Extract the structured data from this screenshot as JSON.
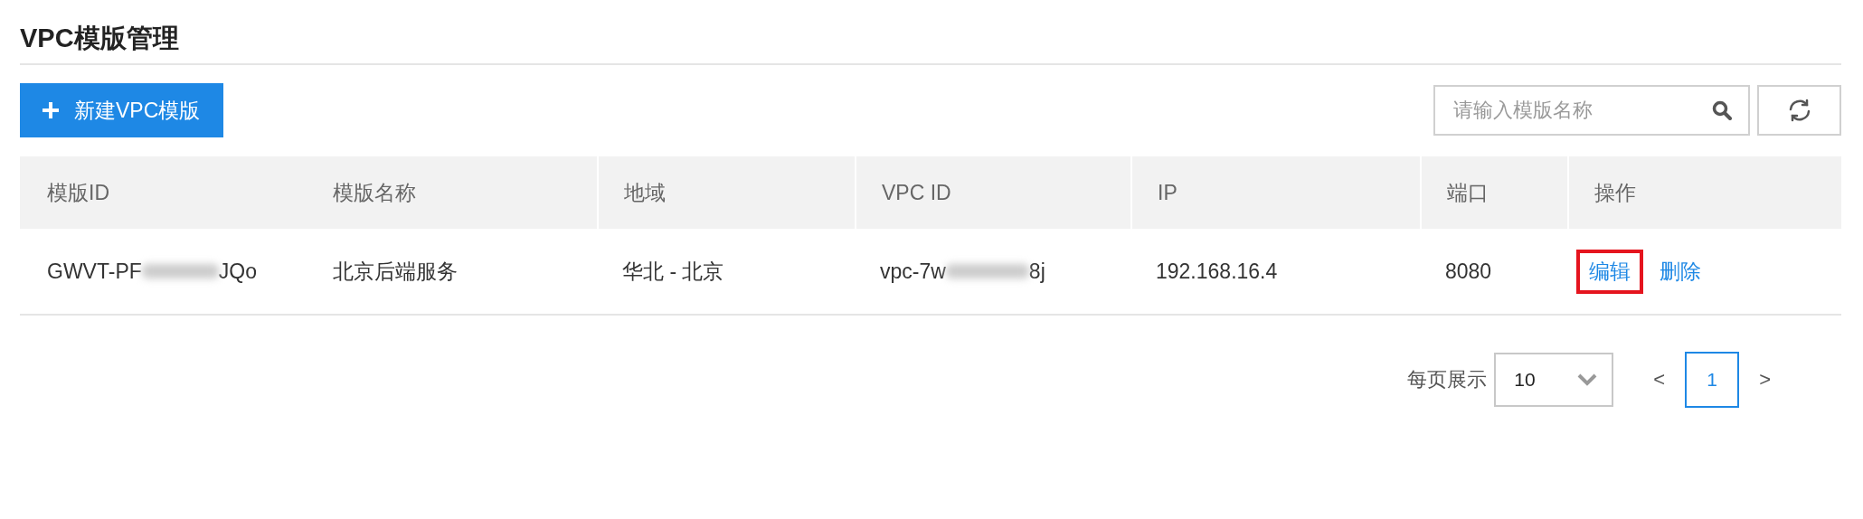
{
  "page": {
    "title": "VPC模版管理"
  },
  "toolbar": {
    "create_button": "新建VPC模版",
    "search": {
      "placeholder": "请输入模版名称"
    }
  },
  "table": {
    "columns": [
      "模版ID",
      "模版名称",
      "地域",
      "VPC ID",
      "IP",
      "端口",
      "操作"
    ],
    "rows": [
      {
        "template_id": {
          "prefix": "GWVT-PF",
          "redacted": true,
          "suffix": "JQo"
        },
        "name": "北京后端服务",
        "region": "华北 - 北京",
        "vpc_id": {
          "prefix": "vpc-7w",
          "redacted": true,
          "suffix": "8j"
        },
        "ip": "192.168.16.4",
        "port": "8080",
        "actions": [
          {
            "label": "编辑",
            "highlighted": true
          },
          {
            "label": "删除",
            "highlighted": false
          }
        ]
      }
    ]
  },
  "pagination": {
    "page_size_label": "每页展示",
    "page_size": "10",
    "prev": "<",
    "next": ">",
    "pages": [
      {
        "label": "1",
        "selected": true
      }
    ]
  }
}
